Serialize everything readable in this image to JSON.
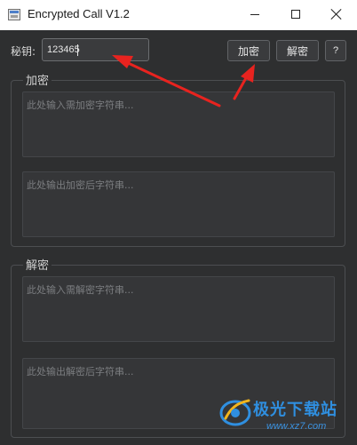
{
  "window": {
    "title": "Encrypted Call V1.2"
  },
  "key_row": {
    "label": "秘钥:",
    "value": "123465",
    "encrypt_button": "加密",
    "decrypt_button": "解密",
    "help_button": "?"
  },
  "encrypt_group": {
    "title": "加密",
    "input_placeholder": "此处输入需加密字符串...",
    "output_placeholder": "此处输出加密后字符串..."
  },
  "decrypt_group": {
    "title": "解密",
    "input_placeholder": "此处输入需解密字符串...",
    "output_placeholder": "此处输出解密后字符串..."
  },
  "watermark": {
    "title": "极光下载站",
    "url": "www.xz7.com"
  },
  "colors": {
    "background": "#2e2f30",
    "annotation_arrow": "#e8231f",
    "watermark": "#2f8fe0"
  }
}
